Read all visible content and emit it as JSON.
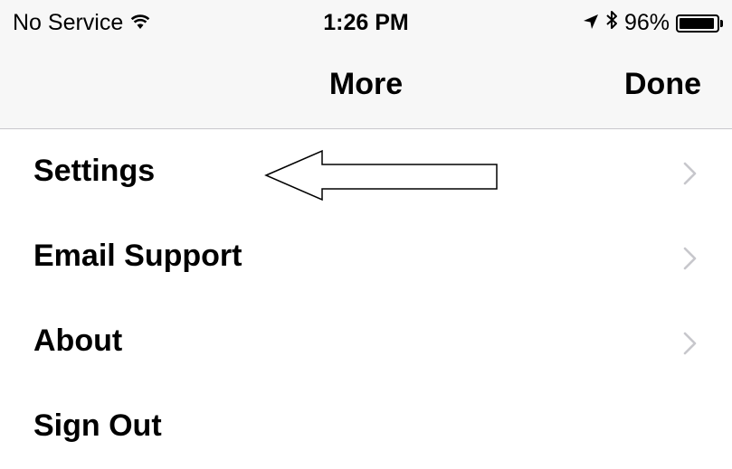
{
  "status_bar": {
    "carrier": "No Service",
    "time": "1:26 PM",
    "battery_text": "96%",
    "battery_level": 0.96
  },
  "nav": {
    "title": "More",
    "done_label": "Done"
  },
  "menu": {
    "items": [
      {
        "label": "Settings",
        "chevron": true
      },
      {
        "label": "Email Support",
        "chevron": true
      },
      {
        "label": "About",
        "chevron": true
      },
      {
        "label": "Sign Out",
        "chevron": false
      }
    ]
  },
  "colors": {
    "nav_background": "#f7f7f7",
    "separator": "#c8c7cc",
    "chevron": "#c7c7cc"
  },
  "icons": [
    "wifi-icon",
    "location-arrow-icon",
    "bluetooth-icon",
    "battery-icon",
    "chevron-right-icon",
    "left-arrow-annotation"
  ]
}
